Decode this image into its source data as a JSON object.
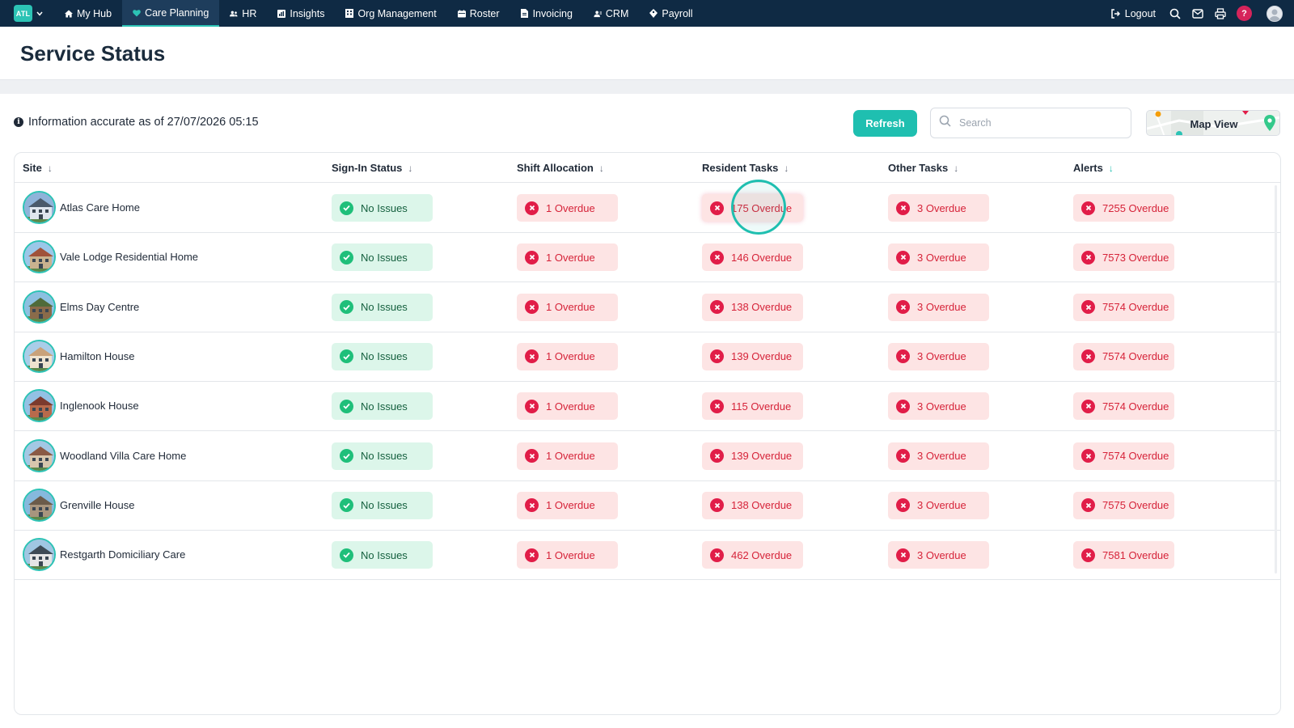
{
  "nav": {
    "logo": "ATL",
    "items": [
      {
        "label": "My Hub",
        "icon": "home-icon"
      },
      {
        "label": "Care Planning",
        "icon": "heart-icon"
      },
      {
        "label": "HR",
        "icon": "people-icon"
      },
      {
        "label": "Insights",
        "icon": "chart-icon"
      },
      {
        "label": "Org Management",
        "icon": "building-icon"
      },
      {
        "label": "Roster",
        "icon": "calendar-icon"
      },
      {
        "label": "Invoicing",
        "icon": "document-icon"
      },
      {
        "label": "CRM",
        "icon": "contacts-icon"
      },
      {
        "label": "Payroll",
        "icon": "tag-icon"
      }
    ],
    "active_index": 1,
    "logout_label": "Logout",
    "help_label": "?"
  },
  "page": {
    "title": "Service Status",
    "info_text": "Information accurate as of 27/07/2026 05:15",
    "refresh_label": "Refresh",
    "search_placeholder": "Search",
    "map_view_label": "Map View"
  },
  "table": {
    "columns": [
      "Site",
      "Sign-In Status",
      "Shift Allocation",
      "Resident Tasks",
      "Other Tasks",
      "Alerts"
    ],
    "rows": [
      {
        "site": "Atlas Care Home",
        "sign_in": "No Issues",
        "shift": "1 Overdue",
        "resident": "175 Overdue",
        "other": "3 Overdue",
        "alerts": "7255 Overdue"
      },
      {
        "site": "Vale Lodge Residential Home",
        "sign_in": "No Issues",
        "shift": "1 Overdue",
        "resident": "146 Overdue",
        "other": "3 Overdue",
        "alerts": "7573 Overdue"
      },
      {
        "site": "Elms Day Centre",
        "sign_in": "No Issues",
        "shift": "1 Overdue",
        "resident": "138 Overdue",
        "other": "3 Overdue",
        "alerts": "7574 Overdue"
      },
      {
        "site": "Hamilton House",
        "sign_in": "No Issues",
        "shift": "1 Overdue",
        "resident": "139 Overdue",
        "other": "3 Overdue",
        "alerts": "7574 Overdue"
      },
      {
        "site": "Inglenook House",
        "sign_in": "No Issues",
        "shift": "1 Overdue",
        "resident": "115 Overdue",
        "other": "3 Overdue",
        "alerts": "7574 Overdue"
      },
      {
        "site": "Woodland Villa Care Home",
        "sign_in": "No Issues",
        "shift": "1 Overdue",
        "resident": "139 Overdue",
        "other": "3 Overdue",
        "alerts": "7574 Overdue"
      },
      {
        "site": "Grenville House",
        "sign_in": "No Issues",
        "shift": "1 Overdue",
        "resident": "138 Overdue",
        "other": "3 Overdue",
        "alerts": "7575 Overdue"
      },
      {
        "site": "Restgarth Domiciliary Care",
        "sign_in": "No Issues",
        "shift": "1 Overdue",
        "resident": "462 Overdue",
        "other": "3 Overdue",
        "alerts": "7581 Overdue"
      }
    ]
  },
  "colors": {
    "nav_bg": "#0f2a44",
    "accent": "#1fbfb0",
    "ok_bg": "#dcf6ea",
    "ok_text": "#15603f",
    "bad_bg": "#fde4e4",
    "bad_text": "#d62339"
  }
}
